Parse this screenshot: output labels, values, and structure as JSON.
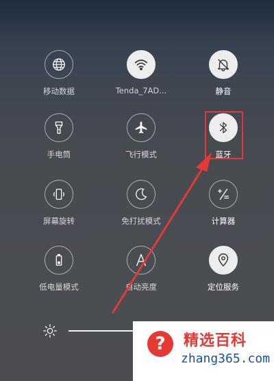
{
  "tiles": [
    {
      "label": "移动数据",
      "icon": "globe-icon",
      "active": false
    },
    {
      "label": "Tenda_7AD...",
      "icon": "wifi-icon",
      "active": true
    },
    {
      "label": "静音",
      "icon": "bell-mute-icon",
      "active": true
    },
    {
      "label": "手电筒",
      "icon": "flashlight-icon",
      "active": false
    },
    {
      "label": "飞行模式",
      "icon": "airplane-icon",
      "active": false
    },
    {
      "label": "蓝牙",
      "icon": "bluetooth-icon",
      "active": false
    },
    {
      "label": "屏幕旋转",
      "icon": "screen-rotate-icon",
      "active": false
    },
    {
      "label": "免打扰模式",
      "icon": "moon-icon",
      "active": false
    },
    {
      "label": "计算器",
      "icon": "calculator-icon",
      "active": false
    },
    {
      "label": "低电量模式",
      "icon": "battery-icon",
      "active": false
    },
    {
      "label": "自动亮度",
      "icon": "auto-brightness-icon",
      "active": false
    },
    {
      "label": "定位服务",
      "icon": "location-icon",
      "active": true
    }
  ],
  "brightness": {
    "icon": "sun-icon"
  },
  "watermark": {
    "brand": "精选百科",
    "domain": "zhang365.com",
    "icon": "question-icon",
    "mark": "?"
  },
  "colors": {
    "highlight": "#e53935",
    "active_tile": "#ededed"
  }
}
